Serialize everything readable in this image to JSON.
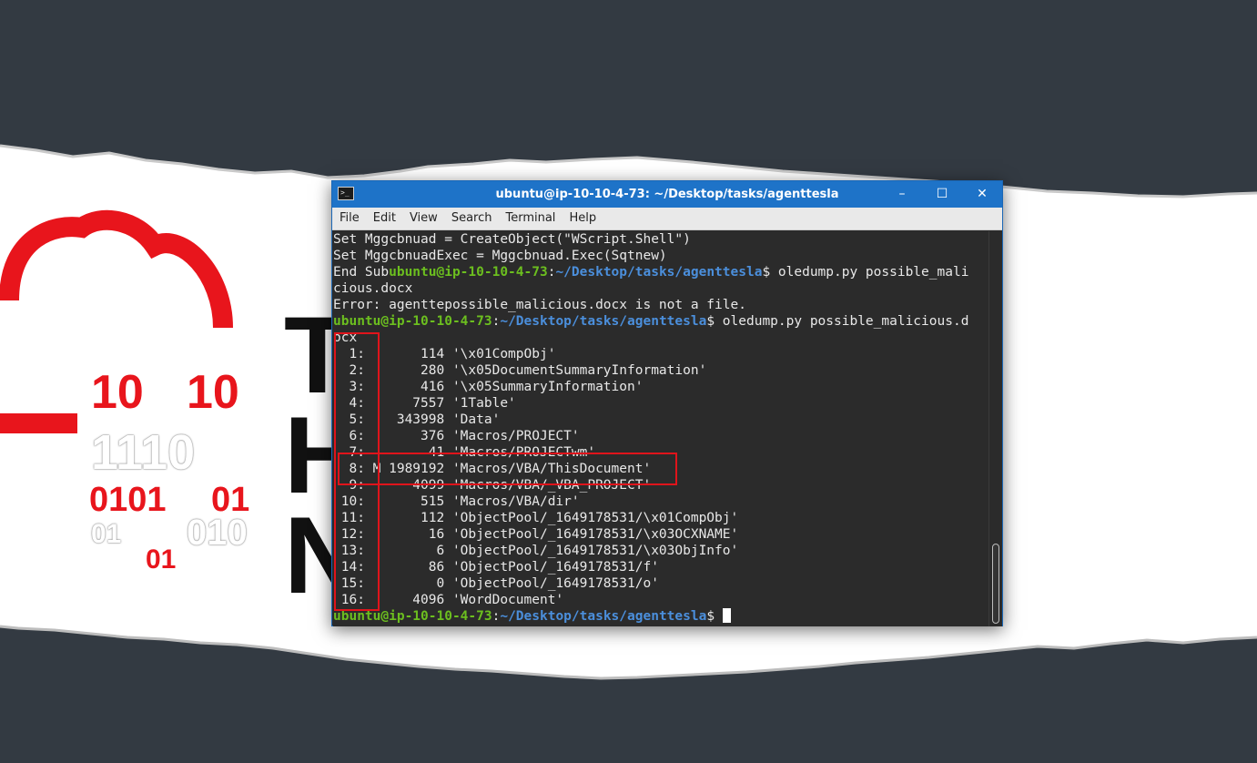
{
  "window": {
    "title": "ubuntu@ip-10-10-4-73: ~/Desktop/tasks/agenttesla",
    "controls": {
      "minimize": "–",
      "maximize": "☐",
      "close": "✕"
    }
  },
  "menu": [
    "File",
    "Edit",
    "View",
    "Search",
    "Terminal",
    "Help"
  ],
  "prompt": {
    "user": "ubuntu@ip-10-10-4-73",
    "sep": ":",
    "path": "~/Desktop/tasks/agenttesla",
    "symbol": "$ "
  },
  "terminal": {
    "line1": "Set Mggcbnuad = CreateObject(\"WScript.Shell\")",
    "line2": "Set MggcbnuadExec = Mggcbnuad.Exec(Sqtnew)",
    "line3_prefix": "End Sub",
    "line3_cmd": "oledump.py possible_mali",
    "line4": "cious.docx",
    "line5": "Error: agenttepossible_malicious.docx is not a file.",
    "line6_cmd": "oledump.py possible_malicious.d",
    "line7": "ocx",
    "streams": [
      "  1:       114 '\\x01CompObj'",
      "  2:       280 '\\x05DocumentSummaryInformation'",
      "  3:       416 '\\x05SummaryInformation'",
      "  4:      7557 '1Table'",
      "  5:    343998 'Data'",
      "  6:       376 'Macros/PROJECT'",
      "  7:        41 'Macros/PROJECTwm'",
      "  8: M 1989192 'Macros/VBA/ThisDocument'",
      "  9:      4099 'Macros/VBA/_VBA_PROJECT'",
      " 10:       515 'Macros/VBA/dir'",
      " 11:       112 'ObjectPool/_1649178531/\\x01CompObj'",
      " 12:        16 'ObjectPool/_1649178531/\\x03OCXNAME'",
      " 13:         6 'ObjectPool/_1649178531/\\x03ObjInfo'",
      " 14:        86 'ObjectPool/_1649178531/f'",
      " 15:         0 'ObjectPool/_1649178531/o'",
      " 16:      4096 'WordDocument'"
    ]
  },
  "logo": {
    "letters": [
      "T",
      "H",
      "N"
    ],
    "binary": [
      "10",
      "10",
      "1110",
      "0101",
      "01",
      "01",
      "010",
      "01"
    ]
  },
  "colors": {
    "background": "#333a42",
    "paper": "#ffffff",
    "titlebar": "#1e73c8",
    "highlight": "#e0141b",
    "prompt_user": "#6cbf1f",
    "prompt_path": "#4b8fdc",
    "logo_red": "#e8151c"
  },
  "icons": {
    "terminal": "terminal-app-icon",
    "minimize": "minimize-icon",
    "maximize": "maximize-icon",
    "close": "close-icon",
    "logo": "cloud-logo-icon"
  }
}
